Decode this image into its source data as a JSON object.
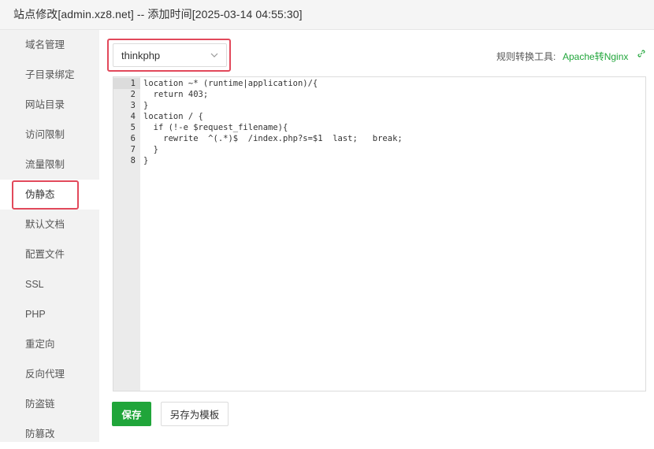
{
  "window": {
    "title": "站点修改[admin.xz8.net] -- 添加时间[2025-03-14 04:55:30]"
  },
  "sidebar": {
    "items": [
      {
        "label": "域名管理"
      },
      {
        "label": "子目录绑定"
      },
      {
        "label": "网站目录"
      },
      {
        "label": "访问限制"
      },
      {
        "label": "流量限制"
      },
      {
        "label": "伪静态",
        "active": true
      },
      {
        "label": "默认文档"
      },
      {
        "label": "配置文件"
      },
      {
        "label": "SSL"
      },
      {
        "label": "PHP"
      },
      {
        "label": "重定向"
      },
      {
        "label": "反向代理"
      },
      {
        "label": "防盗链"
      },
      {
        "label": "防篡改"
      }
    ]
  },
  "rewrite": {
    "selected_template": "thinkphp",
    "tool_label": "规则转换工具:",
    "tool_link": "Apache转Nginx"
  },
  "editor": {
    "line_numbers": [
      "1",
      "2",
      "3",
      "4",
      "5",
      "6",
      "7",
      "8"
    ],
    "lines": [
      "location ~* (runtime|application)/{",
      "  return 403;",
      "}",
      "location / {",
      "  if (!-e $request_filename){",
      "    rewrite  ^(.*)$  /index.php?s=$1  last;   break;",
      "  }",
      "}"
    ]
  },
  "buttons": {
    "save": "保存",
    "save_as_template": "另存为模板"
  },
  "colors": {
    "accent_green": "#20a53a",
    "highlight_red": "#e2495b"
  }
}
